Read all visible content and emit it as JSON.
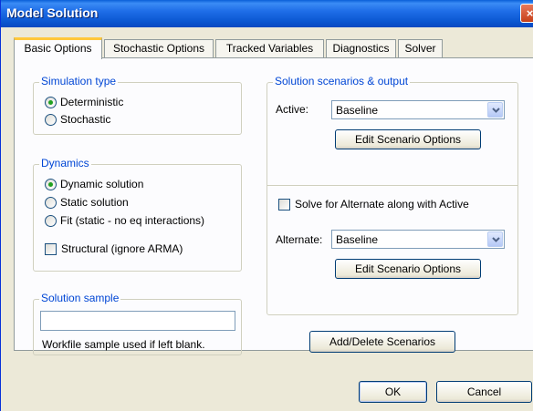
{
  "window": {
    "title": "Model Solution",
    "close_label": "×"
  },
  "tabs": [
    {
      "label": "Basic Options",
      "active": true
    },
    {
      "label": "Stochastic Options",
      "active": false
    },
    {
      "label": "Tracked Variables",
      "active": false
    },
    {
      "label": "Diagnostics",
      "active": false
    },
    {
      "label": "Solver",
      "active": false
    }
  ],
  "simulation_type": {
    "legend": "Simulation type",
    "options": [
      {
        "label": "Deterministic",
        "selected": true
      },
      {
        "label": "Stochastic",
        "selected": false
      }
    ]
  },
  "dynamics": {
    "legend": "Dynamics",
    "options": [
      {
        "label": "Dynamic solution",
        "selected": true
      },
      {
        "label": "Static solution",
        "selected": false
      },
      {
        "label": "Fit (static - no eq interactions)",
        "selected": false
      }
    ],
    "structural_label": "Structural (ignore ARMA)",
    "structural_checked": false
  },
  "solution_sample": {
    "legend": "Solution sample",
    "value": "",
    "note": "Workfile sample used if left blank."
  },
  "scenarios": {
    "legend": "Solution scenarios & output",
    "active_label": "Active:",
    "active_value": "Baseline",
    "edit_active_label": "Edit Scenario Options",
    "solve_alternate_label": "Solve for Alternate along with Active",
    "solve_alternate_checked": false,
    "alternate_label": "Alternate:",
    "alternate_value": "Baseline",
    "edit_alternate_label": "Edit Scenario Options"
  },
  "add_delete_label": "Add/Delete Scenarios",
  "footer": {
    "ok_label": "OK",
    "cancel_label": "Cancel"
  }
}
